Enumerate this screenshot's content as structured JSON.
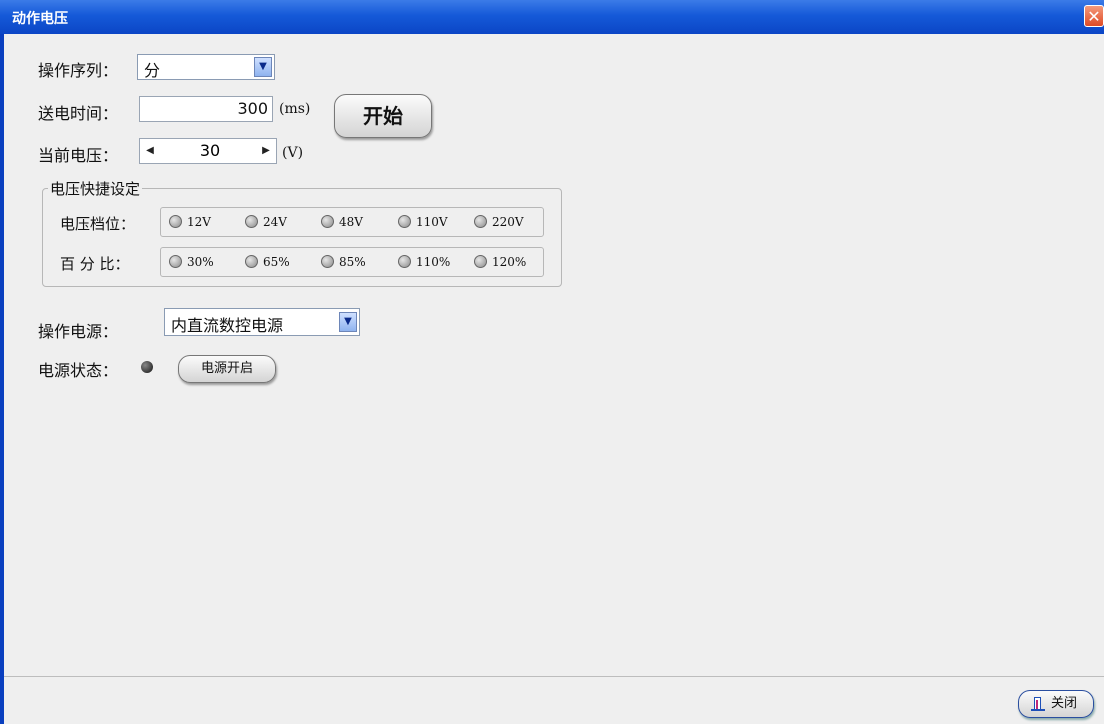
{
  "window": {
    "title": "动作电压",
    "close_glyph": "✕"
  },
  "op_sequence": {
    "label": "操作序列：",
    "value": "分"
  },
  "send_time": {
    "label": "送电时间：",
    "value": "300",
    "unit": "(ms)"
  },
  "start_button": {
    "label": "开始"
  },
  "current_voltage": {
    "label": "当前电压：",
    "value": "30",
    "unit": "(V)"
  },
  "quick_set": {
    "title": "电压快捷设定",
    "level_label": "电压档位：",
    "levels": [
      "12V",
      "24V",
      "48V",
      "110V",
      "220V"
    ],
    "percent_label": "百 分 比：",
    "percents": [
      "30%",
      "65%",
      "85%",
      "110%",
      "120%"
    ]
  },
  "power_source": {
    "label": "操作电源：",
    "value": "内直流数控电源"
  },
  "power_status": {
    "label": "电源状态：",
    "button": "电源开启",
    "led_state": "off"
  },
  "footer": {
    "close_label": "关闭"
  },
  "icons": {
    "combo_arrow": "dropdown-arrow-icon",
    "close_icon": "door-exit-icon"
  }
}
